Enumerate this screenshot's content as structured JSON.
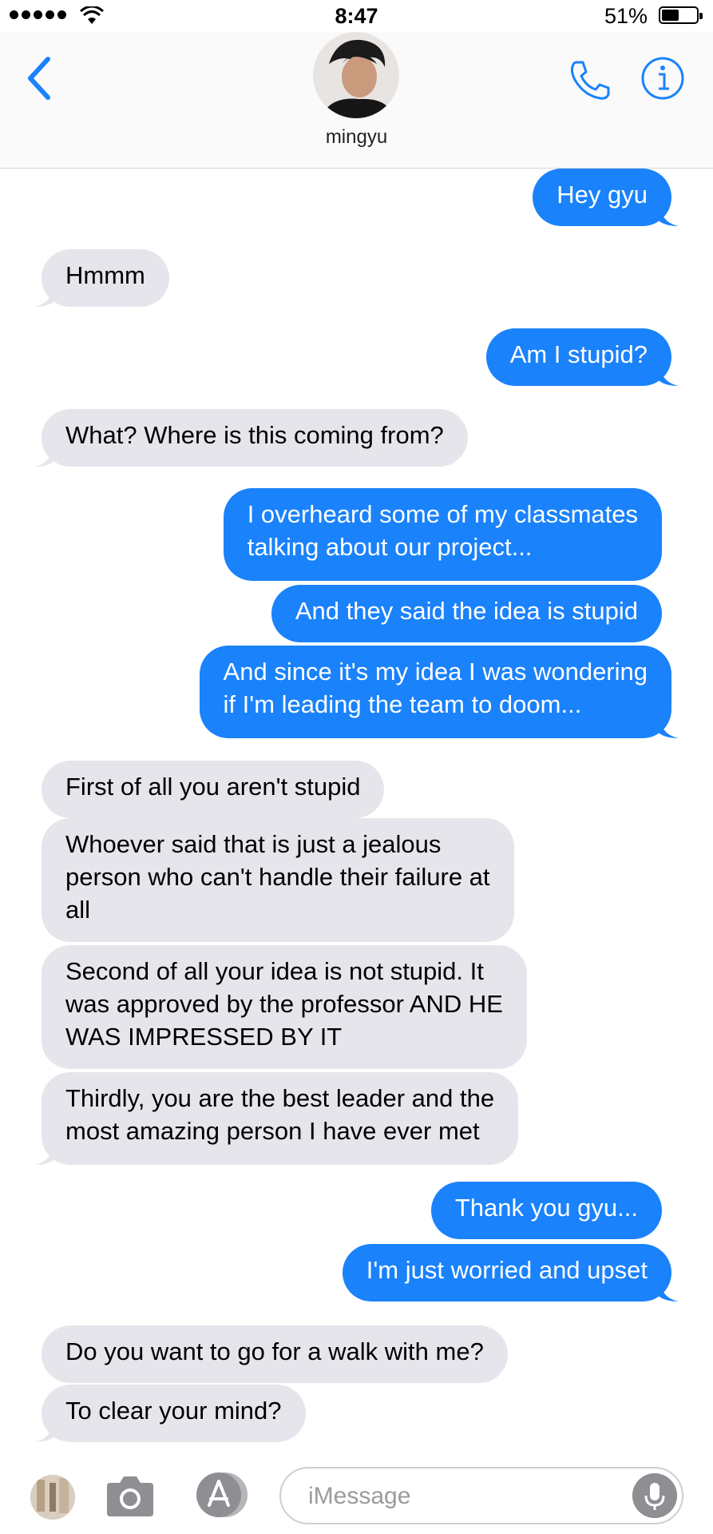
{
  "status_bar": {
    "time": "8:47",
    "battery_percent": "51%",
    "battery_level": 0.51
  },
  "header": {
    "contact_name": "mingyu"
  },
  "messages": [
    {
      "from": "me",
      "text": "Hey gyu"
    },
    {
      "from": "them",
      "text": "Hmmm"
    },
    {
      "from": "me",
      "text": "Am I stupid?"
    },
    {
      "from": "them",
      "text": "What? Where is this coming from?"
    },
    {
      "from": "me",
      "text": "I overheard some of my classmates\ntalking about our project..."
    },
    {
      "from": "me",
      "text": "And they said the idea is stupid"
    },
    {
      "from": "me",
      "text": "And since it's my idea I was wondering\nif I'm leading the team to doom..."
    },
    {
      "from": "them",
      "text": "First of all you aren't stupid"
    },
    {
      "from": "them",
      "text": "Whoever said that is just a jealous\nperson who can't handle their failure at\nall"
    },
    {
      "from": "them",
      "text": "Second of all your idea is not stupid. It\nwas approved by the professor AND HE\nWAS IMPRESSED BY IT"
    },
    {
      "from": "them",
      "text": "Thirdly, you are the best leader and the\nmost amazing person I have ever met"
    },
    {
      "from": "me",
      "text": "Thank you gyu..."
    },
    {
      "from": "me",
      "text": "I'm just worried and upset"
    },
    {
      "from": "them",
      "text": "Do you want to go for a walk with me?"
    },
    {
      "from": "them",
      "text": "To clear your mind?"
    }
  ],
  "input_bar": {
    "placeholder": "iMessage",
    "value": ""
  },
  "colors": {
    "accent": "#1a82fb",
    "incoming_bubble": "#e6e5eb"
  }
}
